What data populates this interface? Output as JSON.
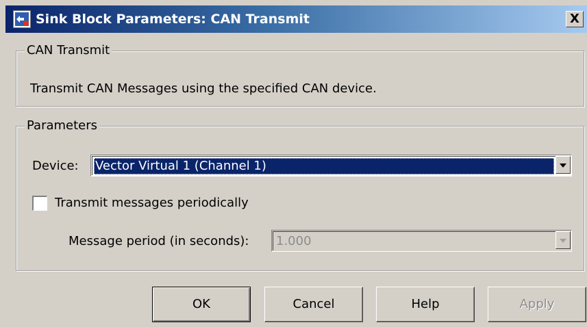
{
  "window": {
    "title": "Sink Block Parameters: CAN Transmit",
    "icon": "simulink-block-icon",
    "close_label": "X"
  },
  "description_group": {
    "legend": "CAN Transmit",
    "text": "Transmit CAN Messages using the specified CAN device."
  },
  "parameters_group": {
    "legend": "Parameters",
    "device": {
      "label": "Device:",
      "value": "Vector Virtual 1 (Channel 1)"
    },
    "periodic": {
      "label": "Transmit messages periodically",
      "checked": false
    },
    "period": {
      "label": "Message period (in seconds):",
      "value": "1.000",
      "enabled": false
    }
  },
  "buttons": {
    "ok": "OK",
    "cancel": "Cancel",
    "help": "Help",
    "apply": "Apply"
  },
  "colors": {
    "dialog_bg": "#d4d0c8",
    "title_active": "#0a246a",
    "selection_bg": "#0a246a",
    "selection_text": "#ffffff",
    "disabled_text": "#8c8c8c"
  }
}
